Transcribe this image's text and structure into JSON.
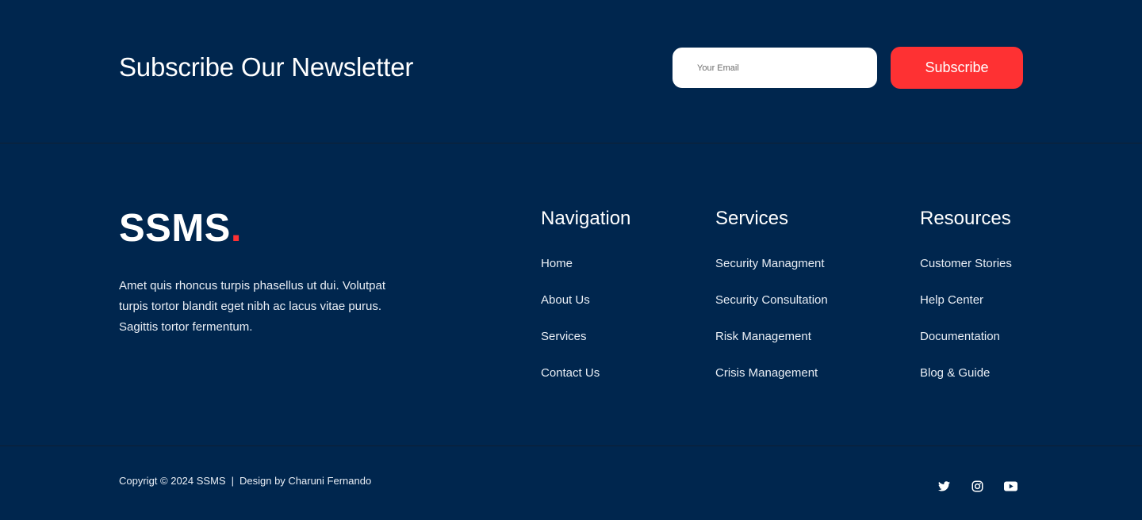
{
  "newsletter": {
    "title": "Subscribe Our Newsletter",
    "email_placeholder": "Your Email",
    "subscribe_label": "Subscribe"
  },
  "brand": {
    "name": "SSMS",
    "dot": ".",
    "description": "Amet quis rhoncus turpis phasellus ut dui. Volutpat turpis tortor blandit eget nibh ac lacus vitae purus. Sagittis tortor fermentum."
  },
  "columns": {
    "navigation": {
      "title": "Navigation",
      "items": [
        "Home",
        "About Us",
        "Services",
        "Contact Us"
      ]
    },
    "services": {
      "title": "Services",
      "items": [
        "Security Managment",
        "Security Consultation",
        "Risk Management",
        "Crisis Management"
      ]
    },
    "resources": {
      "title": "Resources",
      "items": [
        "Customer Stories",
        "Help Center",
        "Documentation",
        "Blog & Guide"
      ]
    }
  },
  "bottom": {
    "copyright": "Copyrigt © 2024 SSMS",
    "separator": "|",
    "design_credit": "Design by Charuni Fernando"
  },
  "socials": [
    "twitter-icon",
    "instagram-icon",
    "youtube-icon"
  ],
  "colors": {
    "background": "#00264e",
    "accent": "#fe3133",
    "text": "#ffffff"
  }
}
